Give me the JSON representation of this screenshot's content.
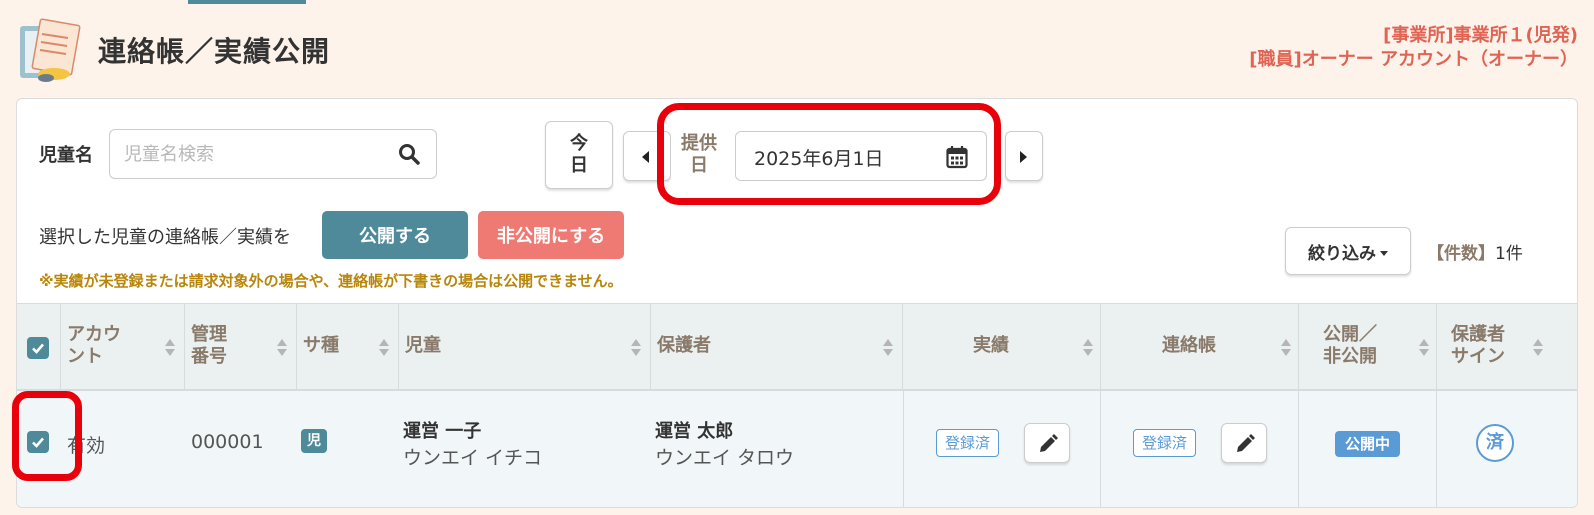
{
  "header": {
    "title": "連絡帳／実績公開",
    "office": "[事業所]事業所１(児発)",
    "staff": "[職員]オーナー アカウント（オーナー）"
  },
  "filters": {
    "name_label": "児童名",
    "search_placeholder": "児童名検索",
    "today_label": "今日",
    "date_label": "提供日",
    "date_value": "2025年6月1日"
  },
  "actions": {
    "select_note": "選択した児童の連絡帳／実績を",
    "publish_label": "公開する",
    "unpublish_label": "非公開にする",
    "warning": "※実績が未登録または請求対象外の場合や、連絡帳が下書きの場合は公開できません。",
    "filter_label": "絞り込み",
    "count_label": "【件数】",
    "count_value": "1件"
  },
  "table": {
    "headers": {
      "account": "アカウント",
      "manage_no": "管理番号",
      "service_type": "サ種",
      "child": "児童",
      "guardian": "保護者",
      "record": "実績",
      "notebook": "連絡帳",
      "publish": "公開／非公開",
      "guardian_sign": "保護者サイン"
    },
    "rows": [
      {
        "checked": true,
        "account": "有効",
        "manage_no": "000001",
        "service_type": "児",
        "child_name": "運営 一子",
        "child_kana": "ウンエイ イチコ",
        "guardian_name": "運営 太郎",
        "guardian_kana": "ウンエイ タロウ",
        "record_status": "登録済",
        "notebook_status": "登録済",
        "publish_status": "公開中",
        "sign_status": "済"
      }
    ]
  },
  "colors": {
    "accent": "#4e8a99",
    "danger_button": "#ee7a73",
    "header_text": "#e06353",
    "highlight": "#e8000b",
    "badge_blue": "#5b9bd5",
    "warning_text": "#b8860b"
  }
}
